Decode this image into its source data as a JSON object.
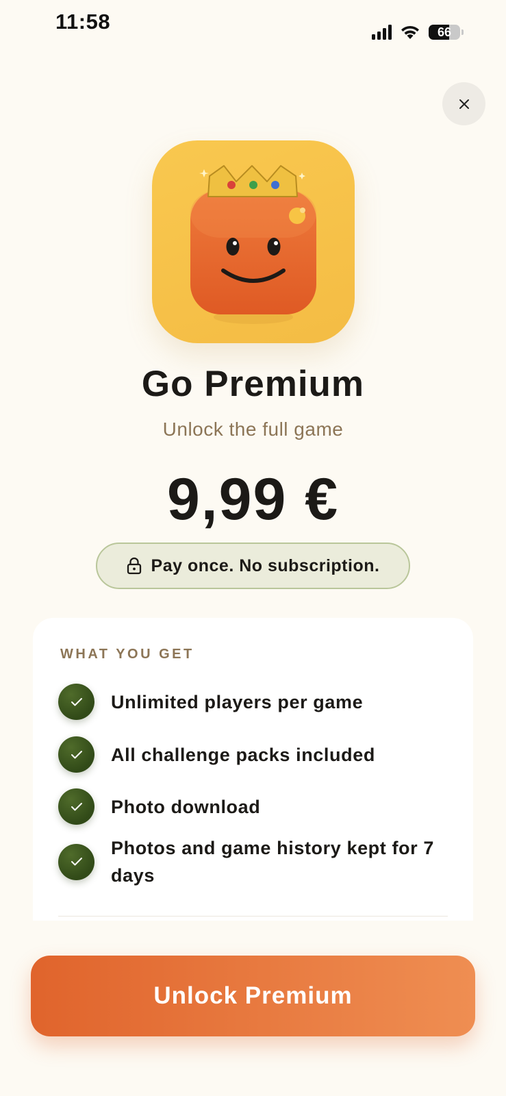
{
  "status_bar": {
    "time": "11:58",
    "battery_level": "66",
    "icons": [
      "signal-icon",
      "wifi-icon",
      "battery-icon"
    ]
  },
  "close_button": {
    "icon": "close-icon"
  },
  "app_icon": {
    "icon": "crowned-smiling-block-icon"
  },
  "header": {
    "title": "Go Premium",
    "subtitle": "Unlock the full game"
  },
  "pricing": {
    "price": "9,99 €",
    "badge_icon": "lock-icon",
    "badge_text": "Pay once. No subscription."
  },
  "benefits": {
    "heading": "WHAT YOU GET",
    "items": [
      {
        "label": "Unlimited players per game",
        "icon": "check-icon"
      },
      {
        "label": "All challenge packs included",
        "icon": "check-icon"
      },
      {
        "label": "Photo download",
        "icon": "check-icon"
      },
      {
        "label": "Photos and game history kept for 7 days",
        "icon": "check-icon"
      }
    ]
  },
  "cta": {
    "label": "Unlock Premium"
  },
  "colors": {
    "background": "#fdfaf3",
    "accent": "#e0642c",
    "check_green": "#314a18",
    "muted_text": "#8c7556",
    "app_icon_yellow": "#f9c84f"
  }
}
